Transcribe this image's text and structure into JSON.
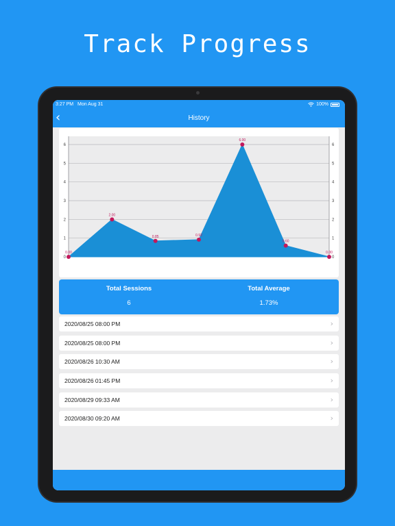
{
  "headline": "Track Progress",
  "status_bar": {
    "time": "3:27 PM",
    "date": "Mon Aug 31",
    "battery": "100%"
  },
  "nav": {
    "title": "History",
    "back_icon": "chevron-left-icon"
  },
  "chart_data": {
    "type": "area",
    "x": [
      1,
      2,
      3,
      4,
      5,
      6,
      7
    ],
    "values": [
      0.0,
      2.0,
      0.85,
      0.92,
      6.0,
      0.6,
      0.0
    ],
    "data_labels": [
      "0.00",
      "2.00",
      "0.85",
      "0.92",
      "6.00",
      "0.60",
      "0.00"
    ],
    "y_ticks": [
      "0",
      "1",
      "2",
      "3",
      "4",
      "5",
      "6"
    ],
    "ylim": [
      0,
      6
    ],
    "grid": true,
    "fill_color": "#1a8fd6",
    "point_color": "#c2185b",
    "label_color": "#c2185b"
  },
  "summary": {
    "sessions_label": "Total Sessions",
    "sessions_value": "6",
    "average_label": "Total Average",
    "average_value": "1.73%"
  },
  "history": [
    {
      "datetime": "2020/08/25 08:00 PM"
    },
    {
      "datetime": "2020/08/25 08:00 PM"
    },
    {
      "datetime": "2020/08/26 10:30 AM"
    },
    {
      "datetime": "2020/08/26 01:45 PM"
    },
    {
      "datetime": "2020/08/29 09:33 AM"
    },
    {
      "datetime": "2020/08/30 09:20 AM"
    }
  ],
  "colors": {
    "accent": "#2196F3",
    "background": "#ececed"
  }
}
